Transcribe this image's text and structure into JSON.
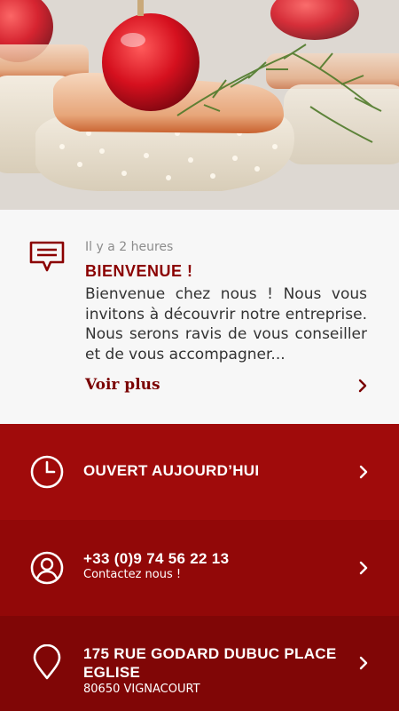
{
  "hero": {
    "image": "appetizer-photo"
  },
  "news": {
    "icon": "message-icon",
    "time": "Il y a 2 heures",
    "title": "BIENVENUE !",
    "body": "Bienvenue chez nous ! Nous vous invitons à découvrir notre entreprise. Nous serons ravis de vous conseiller et de vous accompagner...",
    "more_label": "Voir plus"
  },
  "hours": {
    "icon": "clock-icon",
    "title": "OUVERT AUJOURD’HUI"
  },
  "phone": {
    "icon": "user-icon",
    "title": "+33 (0)9 74 56 22 13",
    "subtitle": "Contactez nous !"
  },
  "address": {
    "icon": "map-pin-icon",
    "title_line1": "175 RUE GODARD DUBUC PLACE",
    "title_line2": "EGLISE",
    "subtitle": "80650 VIGNACOURT"
  },
  "colors": {
    "accent": "#8b0000",
    "row1": "#a00b0b",
    "row2": "#920808",
    "row3": "#800606"
  }
}
